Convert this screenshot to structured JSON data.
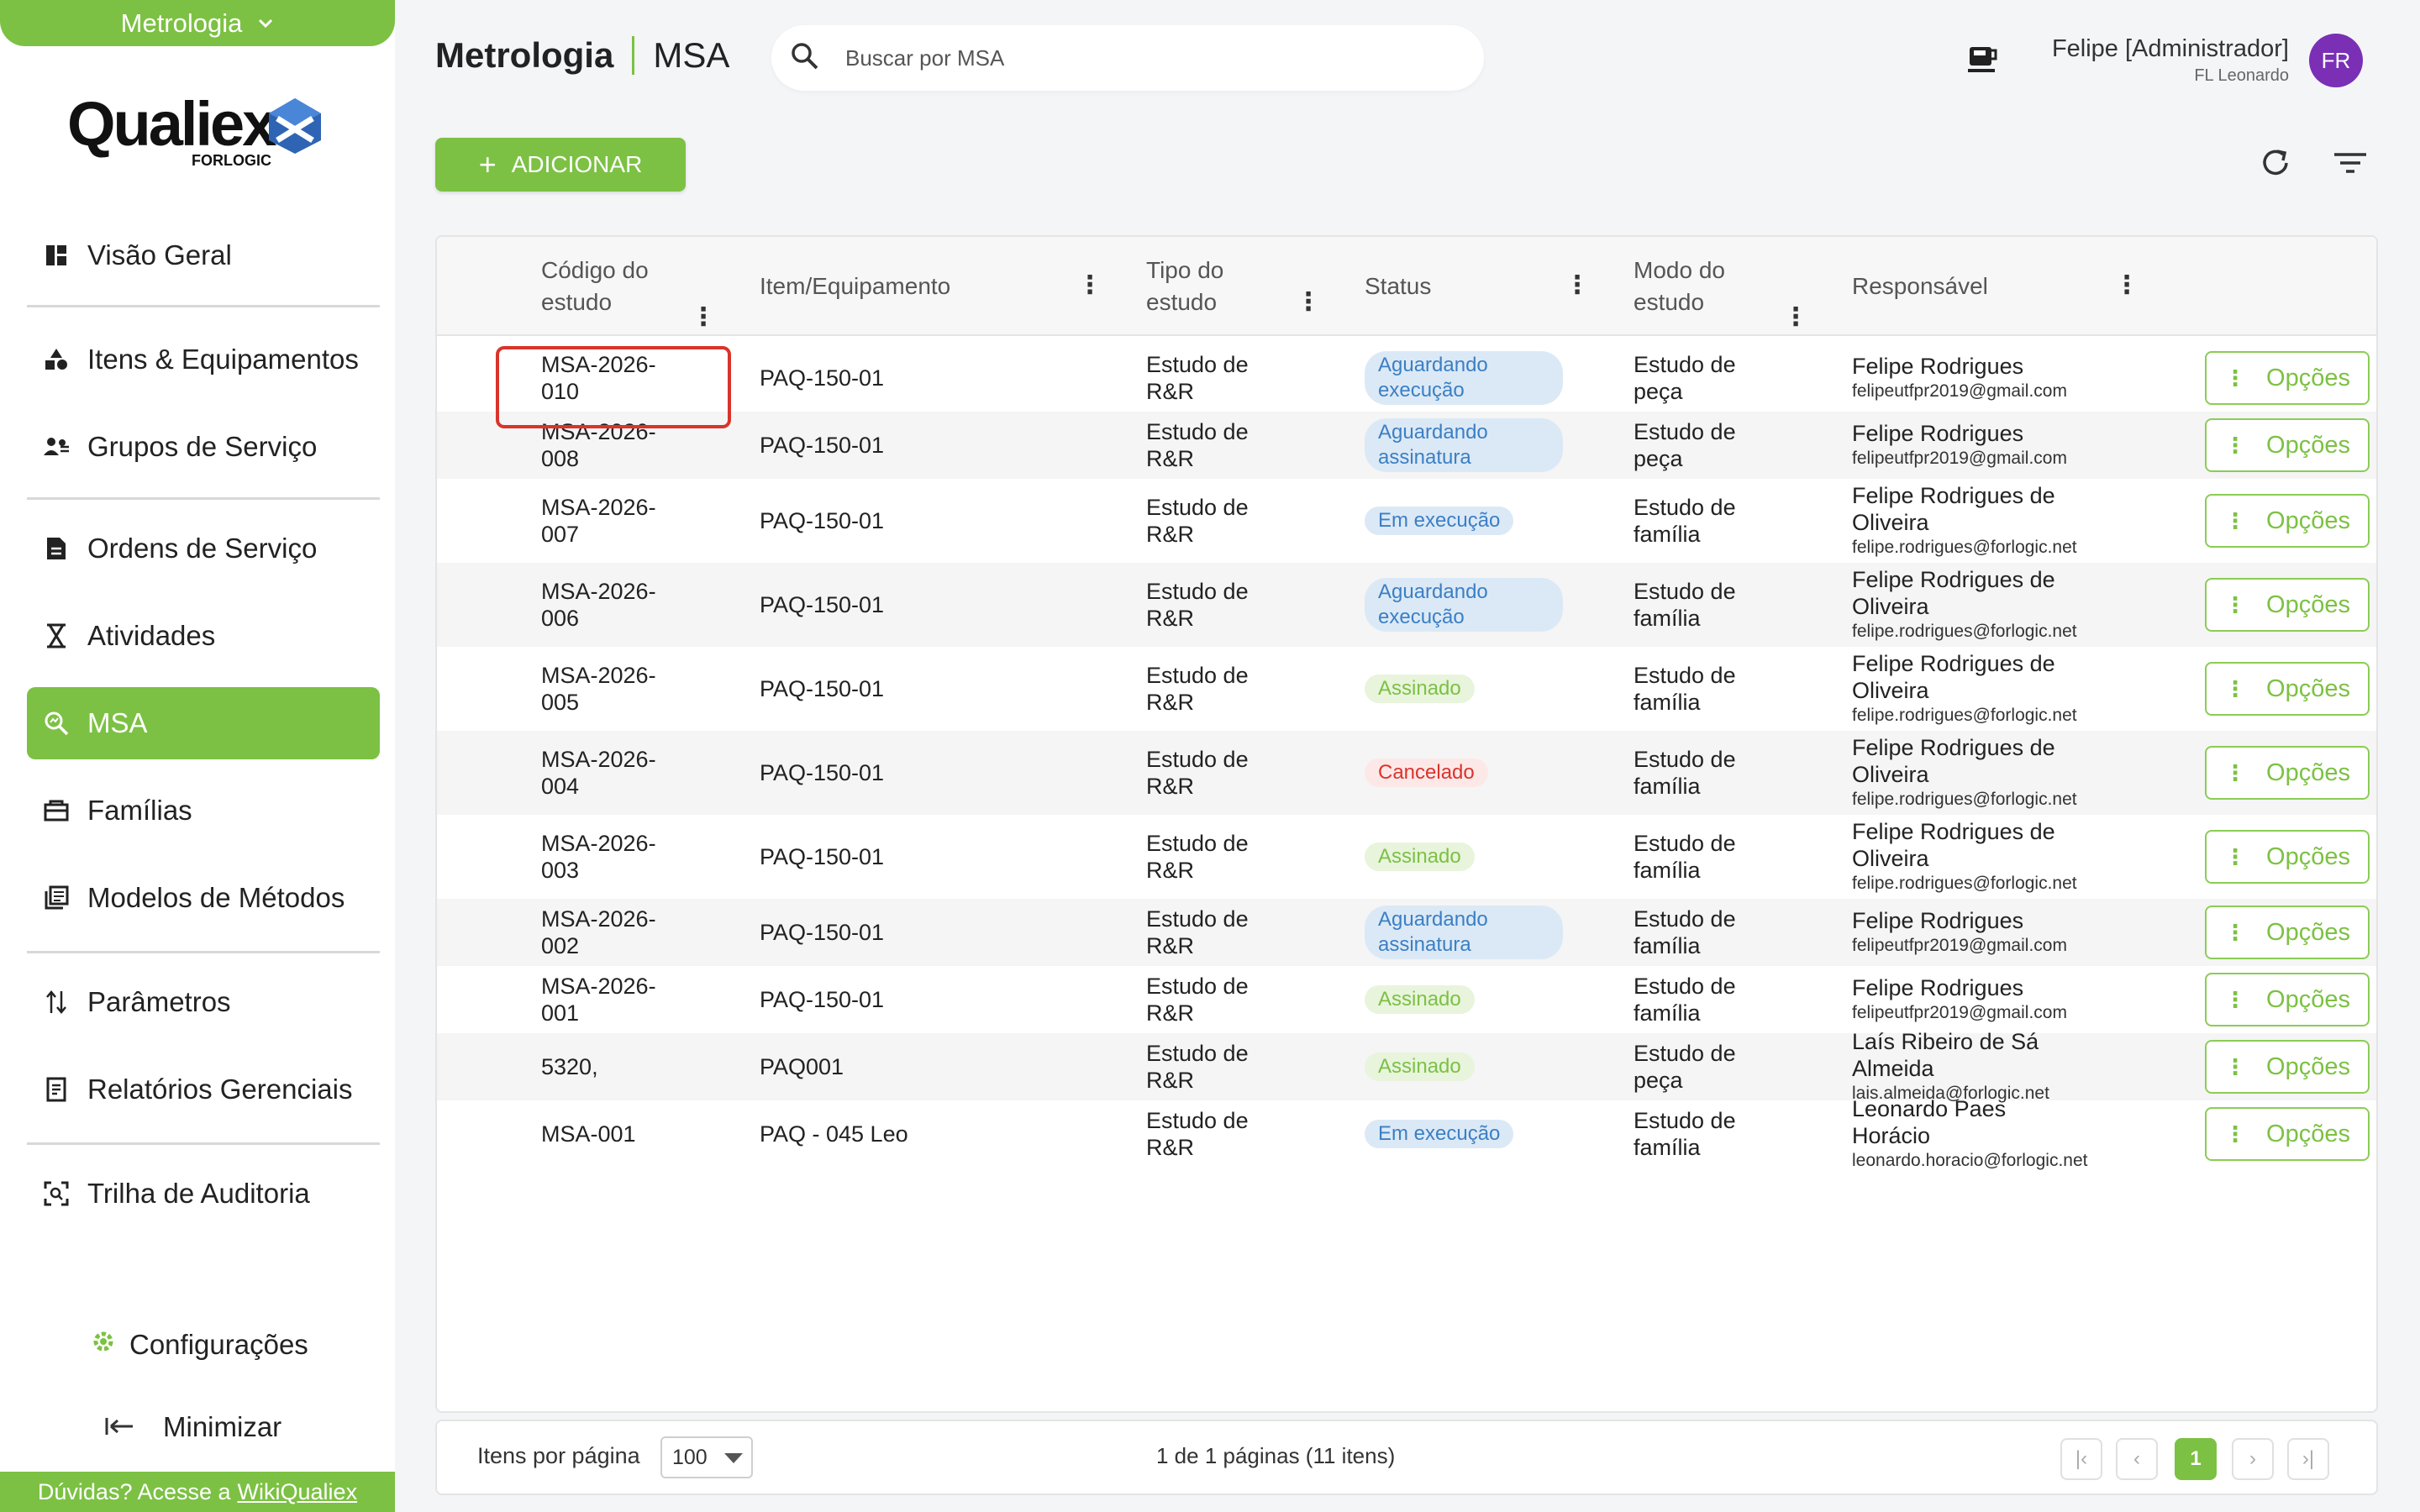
{
  "sidebar": {
    "module": "Metrologia",
    "logo_brand": "Qualiex",
    "logo_sub": "FORLOGIC",
    "items": [
      {
        "label": "Visão Geral",
        "icon": "dashboard-icon"
      },
      {
        "label": "Itens & Equipamentos",
        "icon": "shapes-icon"
      },
      {
        "label": "Grupos de Serviço",
        "icon": "group-icon"
      },
      {
        "label": "Ordens de Serviço",
        "icon": "document-icon"
      },
      {
        "label": "Atividades",
        "icon": "hourglass-icon"
      },
      {
        "label": "MSA",
        "icon": "msa-search-icon"
      },
      {
        "label": "Famílias",
        "icon": "folder-icon"
      },
      {
        "label": "Modelos de Métodos",
        "icon": "library-icon"
      },
      {
        "label": "Parâmetros",
        "icon": "sort-arrows-icon"
      },
      {
        "label": "Relatórios Gerenciais",
        "icon": "report-icon"
      },
      {
        "label": "Trilha de Auditoria",
        "icon": "audit-icon"
      }
    ],
    "settings_label": "Configurações",
    "minimize_label": "Minimizar",
    "help_text": "Dúvidas? Acesse a",
    "help_link": "WikiQualiex"
  },
  "header": {
    "title_module": "Metrologia",
    "title_page": "MSA",
    "search_placeholder": "Buscar por MSA",
    "user_name": "Felipe [Administrador]",
    "user_org": "FL Leonardo",
    "avatar_initials": "FR"
  },
  "toolbar": {
    "add_label": "ADICIONAR"
  },
  "table": {
    "columns": [
      "Código do estudo",
      "Item/Equipamento",
      "Tipo do estudo",
      "Status",
      "Modo do estudo",
      "Responsável"
    ],
    "options_label": "Opções",
    "rows": [
      {
        "code": "MSA-2026-010",
        "item": "PAQ-150-01",
        "type": "Estudo de R&R",
        "status": "Aguardando execução",
        "status_color": "blue",
        "mode": "Estudo de peça",
        "resp_name": "Felipe Rodrigues",
        "resp_email": "felipeutfpr2019@gmail.com"
      },
      {
        "code": "MSA-2026-008",
        "item": "PAQ-150-01",
        "type": "Estudo de R&R",
        "status": "Aguardando assinatura",
        "status_color": "blue",
        "mode": "Estudo de peça",
        "resp_name": "Felipe Rodrigues",
        "resp_email": "felipeutfpr2019@gmail.com"
      },
      {
        "code": "MSA-2026-007",
        "item": "PAQ-150-01",
        "type": "Estudo de R&R",
        "status": "Em execução",
        "status_color": "blue",
        "mode": "Estudo de família",
        "resp_name": "Felipe Rodrigues de Oliveira",
        "resp_email": "felipe.rodrigues@forlogic.net"
      },
      {
        "code": "MSA-2026-006",
        "item": "PAQ-150-01",
        "type": "Estudo de R&R",
        "status": "Aguardando execução",
        "status_color": "blue",
        "mode": "Estudo de família",
        "resp_name": "Felipe Rodrigues de Oliveira",
        "resp_email": "felipe.rodrigues@forlogic.net"
      },
      {
        "code": "MSA-2026-005",
        "item": "PAQ-150-01",
        "type": "Estudo de R&R",
        "status": "Assinado",
        "status_color": "green",
        "mode": "Estudo de família",
        "resp_name": "Felipe Rodrigues de Oliveira",
        "resp_email": "felipe.rodrigues@forlogic.net"
      },
      {
        "code": "MSA-2026-004",
        "item": "PAQ-150-01",
        "type": "Estudo de R&R",
        "status": "Cancelado",
        "status_color": "red",
        "mode": "Estudo de família",
        "resp_name": "Felipe Rodrigues de Oliveira",
        "resp_email": "felipe.rodrigues@forlogic.net"
      },
      {
        "code": "MSA-2026-003",
        "item": "PAQ-150-01",
        "type": "Estudo de R&R",
        "status": "Assinado",
        "status_color": "green",
        "mode": "Estudo de família",
        "resp_name": "Felipe Rodrigues de Oliveira",
        "resp_email": "felipe.rodrigues@forlogic.net"
      },
      {
        "code": "MSA-2026-002",
        "item": "PAQ-150-01",
        "type": "Estudo de R&R",
        "status": "Aguardando assinatura",
        "status_color": "blue",
        "mode": "Estudo de família",
        "resp_name": "Felipe Rodrigues",
        "resp_email": "felipeutfpr2019@gmail.com"
      },
      {
        "code": "MSA-2026-001",
        "item": "PAQ-150-01",
        "type": "Estudo de R&R",
        "status": "Assinado",
        "status_color": "green",
        "mode": "Estudo de família",
        "resp_name": "Felipe Rodrigues",
        "resp_email": "felipeutfpr2019@gmail.com"
      },
      {
        "code": "5320,",
        "item": "PAQ001",
        "type": "Estudo de R&R",
        "status": "Assinado",
        "status_color": "green",
        "mode": "Estudo de peça",
        "resp_name": "Laís Ribeiro de Sá Almeida",
        "resp_email": "lais.almeida@forlogic.net"
      },
      {
        "code": "MSA-001",
        "item": "PAQ - 045 Leo",
        "type": "Estudo de R&R",
        "status": "Em execução",
        "status_color": "blue",
        "mode": "Estudo de família",
        "resp_name": "Leonardo Paes Horácio",
        "resp_email": "leonardo.horacio@forlogic.net"
      }
    ]
  },
  "footer": {
    "items_per_page_label": "Itens por página",
    "items_per_page_value": "100",
    "page_info": "1 de 1 páginas (11 itens)",
    "current_page": "1"
  },
  "colors": {
    "accent": "#7cc143",
    "status_blue_bg": "#dbe9f6",
    "status_blue_text": "#3b7fc4",
    "status_green_bg": "#e8f4dc",
    "status_red_text": "#d9342b",
    "highlight_border": "#d9342b",
    "avatar": "#7a2fb5"
  }
}
